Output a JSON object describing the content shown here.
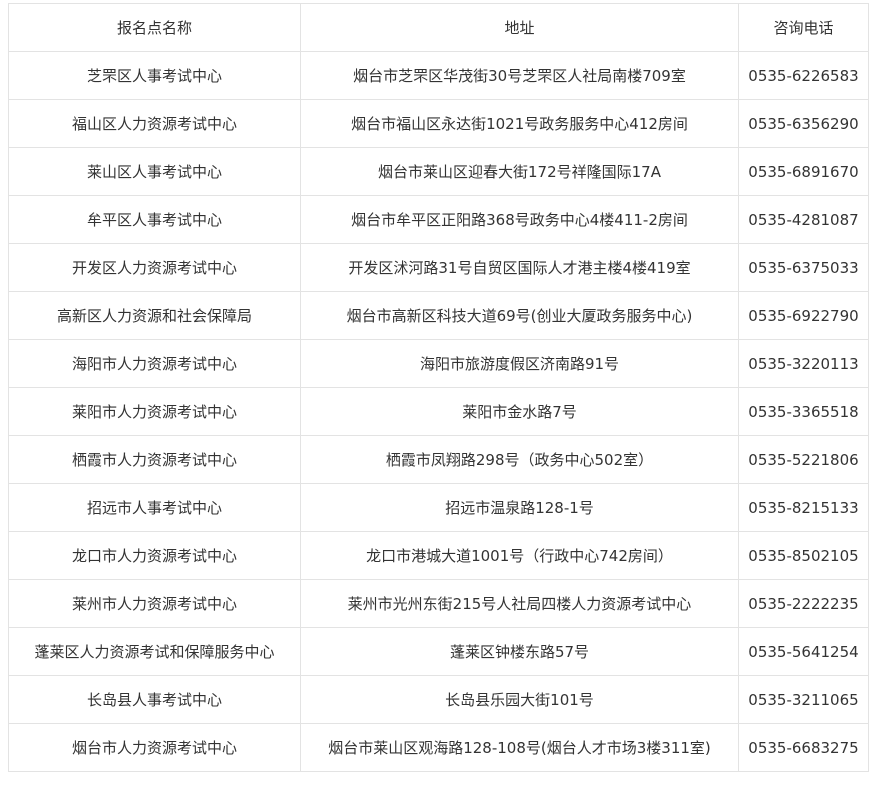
{
  "table": {
    "headers": [
      "报名点名称",
      "地址",
      "咨询电话"
    ],
    "rows": [
      [
        "芝罘区人事考试中心",
        "烟台市芝罘区华茂街30号芝罘区人社局南楼709室",
        "0535-6226583"
      ],
      [
        "福山区人力资源考试中心",
        "烟台市福山区永达街1021号政务服务中心412房间",
        "0535-6356290"
      ],
      [
        "莱山区人事考试中心",
        "烟台市莱山区迎春大街172号祥隆国际17A",
        "0535-6891670"
      ],
      [
        "牟平区人事考试中心",
        "烟台市牟平区正阳路368号政务中心4楼411-2房间",
        "0535-4281087"
      ],
      [
        "开发区人力资源考试中心",
        "开发区沭河路31号自贸区国际人才港主楼4楼419室",
        "0535-6375033"
      ],
      [
        "高新区人力资源和社会保障局",
        "烟台市高新区科技大道69号(创业大厦政务服务中心)",
        "0535-6922790"
      ],
      [
        "海阳市人力资源考试中心",
        "海阳市旅游度假区济南路91号",
        "0535-3220113"
      ],
      [
        "莱阳市人力资源考试中心",
        "莱阳市金水路7号",
        "0535-3365518"
      ],
      [
        "栖霞市人力资源考试中心",
        "栖霞市凤翔路298号（政务中心502室）",
        "0535-5221806"
      ],
      [
        "招远市人事考试中心",
        "招远市温泉路128-1号",
        "0535-8215133"
      ],
      [
        "龙口市人力资源考试中心",
        "龙口市港城大道1001号（行政中心742房间）",
        "0535-8502105"
      ],
      [
        "莱州市人力资源考试中心",
        "莱州市光州东街215号人社局四楼人力资源考试中心",
        "0535-2222235"
      ],
      [
        "蓬莱区人力资源考试和保障服务中心",
        "蓬莱区钟楼东路57号",
        "0535-5641254"
      ],
      [
        "长岛县人事考试中心",
        "长岛县乐园大街101号",
        "0535-3211065"
      ],
      [
        "烟台市人力资源考试中心",
        "烟台市莱山区观海路128-108号(烟台人才市场3楼311室)",
        "0535-6683275"
      ]
    ]
  }
}
